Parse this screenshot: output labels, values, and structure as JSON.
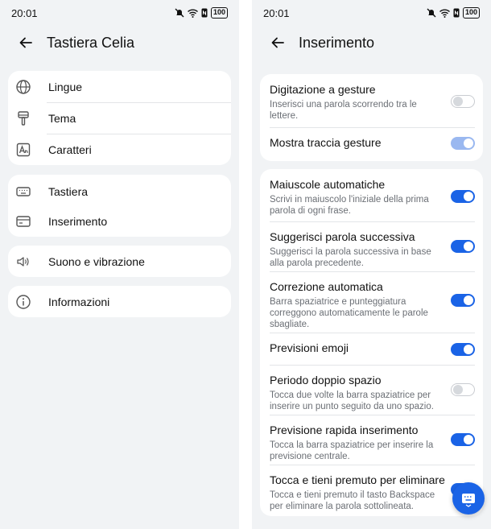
{
  "status_bar": {
    "time": "20:01",
    "battery": "100"
  },
  "left_screen": {
    "title": "Tastiera Celia",
    "groups": [
      {
        "items": [
          {
            "label": "Lingue",
            "icon": "globe-icon"
          },
          {
            "label": "Tema",
            "icon": "paintbrush-icon"
          },
          {
            "label": "Caratteri",
            "icon": "font-icon"
          }
        ]
      },
      {
        "items": [
          {
            "label": "Tastiera",
            "icon": "keyboard-icon"
          },
          {
            "label": "Inserimento",
            "icon": "input-icon"
          }
        ]
      },
      {
        "items": [
          {
            "label": "Suono e vibrazione",
            "icon": "speaker-icon"
          }
        ]
      },
      {
        "items": [
          {
            "label": "Informazioni",
            "icon": "info-icon"
          }
        ]
      }
    ]
  },
  "right_screen": {
    "title": "Inserimento",
    "group1": [
      {
        "title": "Digitazione a gesture",
        "desc": "Inserisci una parola scorrendo tra le lettere.",
        "state": "off"
      },
      {
        "title": "Mostra traccia gesture",
        "desc": "",
        "state": "disabled-on"
      }
    ],
    "group2": [
      {
        "title": "Maiuscole automatiche",
        "desc": "Scrivi in maiuscolo l'iniziale della prima parola di ogni frase.",
        "state": "on"
      },
      {
        "title": "Suggerisci parola successiva",
        "desc": "Suggerisci la parola successiva in base alla parola precedente.",
        "state": "on"
      },
      {
        "title": "Correzione automatica",
        "desc": "Barra spaziatrice e punteggiatura correggono automaticamente le parole sbagliate.",
        "state": "on"
      },
      {
        "title": "Previsioni emoji",
        "desc": "",
        "state": "on"
      },
      {
        "title": "Periodo doppio spazio",
        "desc": "Tocca due volte la barra spaziatrice per inserire un punto seguito da uno spazio.",
        "state": "off"
      },
      {
        "title": "Previsione rapida inserimento",
        "desc": "Tocca la barra spaziatrice per inserire la previsione centrale.",
        "state": "on"
      },
      {
        "title": "Tocca e tieni premuto per eliminare",
        "desc": "Tocca e tieni premuto il tasto Backspace per eliminare la parola sottolineata.",
        "state": "on"
      }
    ],
    "fab_icon": "keyboard-icon"
  },
  "colors": {
    "accent": "#1a63e6",
    "background": "#f1f3f5",
    "card": "#ffffff"
  }
}
